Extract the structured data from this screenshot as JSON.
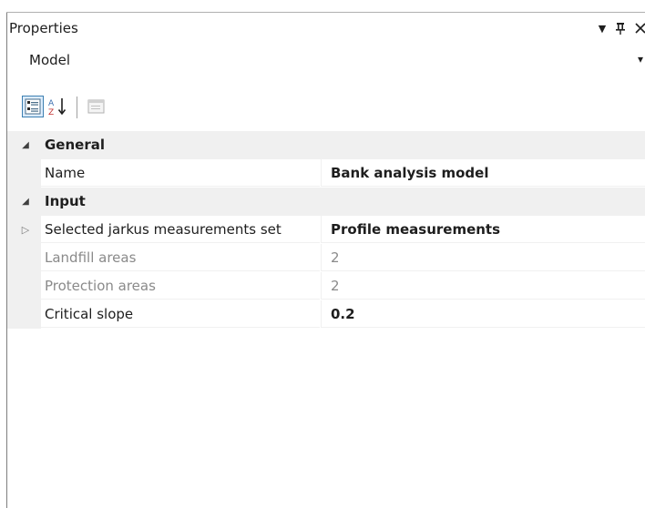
{
  "panel": {
    "title": "Properties",
    "buttons": {
      "dropdown_glyph": "▼",
      "pin_glyph": "ᛘ",
      "close_glyph": "✕"
    }
  },
  "object_selector": {
    "value": "Model",
    "arrow_glyph": "▾"
  },
  "toolbar": {
    "categorized_icon": "categorized-icon",
    "alphabetical_icon": "alphabetical-sort-icon",
    "property_pages_icon": "property-pages-icon"
  },
  "grid": {
    "categories": [
      {
        "label": "General",
        "expander": "◢",
        "properties": [
          {
            "name": "Name",
            "value": "Bank analysis model",
            "bold_value": true,
            "readonly": false,
            "expander": ""
          }
        ]
      },
      {
        "label": "Input",
        "expander": "◢",
        "properties": [
          {
            "name": "Selected jarkus measurements set",
            "value": "Profile measurements",
            "bold_value": true,
            "readonly": false,
            "expander": "▷"
          },
          {
            "name": "Landfill areas",
            "value": "2",
            "bold_value": false,
            "readonly": true,
            "expander": ""
          },
          {
            "name": "Protection areas",
            "value": "2",
            "bold_value": false,
            "readonly": true,
            "expander": ""
          },
          {
            "name": "Critical slope",
            "value": "0.2",
            "bold_value": true,
            "readonly": false,
            "expander": ""
          }
        ]
      }
    ]
  },
  "colors": {
    "gutter": "#f0f0f0",
    "readonly_text": "#8a8a8a",
    "toolbar_selected": "#dcecfc"
  }
}
